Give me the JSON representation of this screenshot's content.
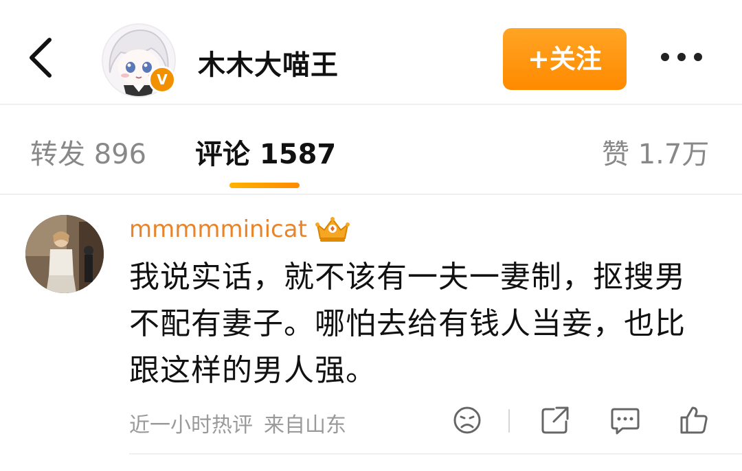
{
  "header": {
    "back_icon": "chevron-left-icon",
    "username": "木木大喵王",
    "verified_badge": "V",
    "follow_label": "+关注",
    "more_icon": "more-horizontal-icon"
  },
  "tabs": [
    {
      "label": "转发 896",
      "active": false
    },
    {
      "label": "评论 1587",
      "active": true
    },
    {
      "label": "赞 1.7万",
      "active": false
    }
  ],
  "comment": {
    "username": "mmmmminicat",
    "badge_icon": "crown-badge-icon",
    "text": "我说实话，就不该有一夫一妻制，抠搜男不配有妻子。哪怕去给有钱人当妾，也比跟这样的男人强。",
    "meta_time": "近一小时热评",
    "meta_location": "来自山东",
    "actions": [
      "dislike-face-icon",
      "share-icon",
      "comment-icon",
      "like-icon"
    ]
  },
  "colors": {
    "accent": "#ff8a00",
    "comment_username": "#e8842a",
    "muted": "#9a9a9a"
  }
}
